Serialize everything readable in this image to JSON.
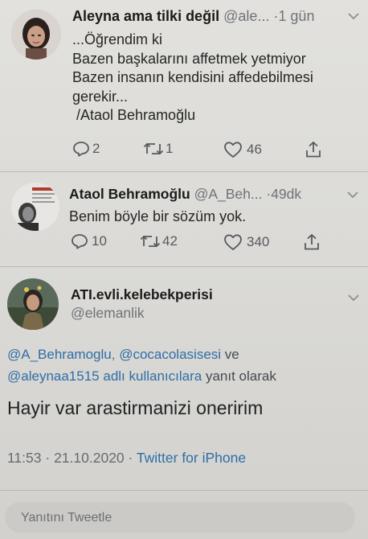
{
  "tweet1": {
    "name": "Aleyna ama tilki değil",
    "handle": "@ale...",
    "sep": "·",
    "time": "1 gün",
    "lines": [
      "...Öğrendim ki",
      "Bazen başkalarını affetmek yetmiyor",
      "Bazen insanın kendisini affedebilmesi",
      "gerekir...",
      " /Ataol Behramoğlu"
    ],
    "replies": "2",
    "retweets": "1",
    "likes": "46"
  },
  "tweet2": {
    "name": "Ataol Behramoğlu",
    "handle": "@A_Beh...",
    "sep": "·",
    "time": "49dk",
    "text": "Benim böyle bir sözüm yok.",
    "replies": "10",
    "retweets": "42",
    "likes": "340"
  },
  "tweet3": {
    "name": "ATI.evli.kelebekperisi",
    "handle": "@elemanlik",
    "reply_to": {
      "user1": "@A_Behramoglu",
      "comma": ",",
      "user2": "@cocacolasisesi",
      "and": "ve",
      "user3": "@aleynaa1515",
      "suffix1": "adlı kullanıcılara",
      "suffix2": "yanıt olarak"
    },
    "text": "Hayir var arastirmanizi oneririm",
    "time": "11:53",
    "dot": "·",
    "date": "21.10.2020",
    "dot2": "·",
    "source": "Twitter for iPhone"
  },
  "reply_placeholder": "Yanıtını Tweetle",
  "colors": {
    "link": "#2f6ea8",
    "muted": "#6f7378",
    "background": "#dcdbd7"
  },
  "icons": [
    "reply-icon",
    "retweet-icon",
    "like-icon",
    "share-icon",
    "chevron-down-icon"
  ]
}
